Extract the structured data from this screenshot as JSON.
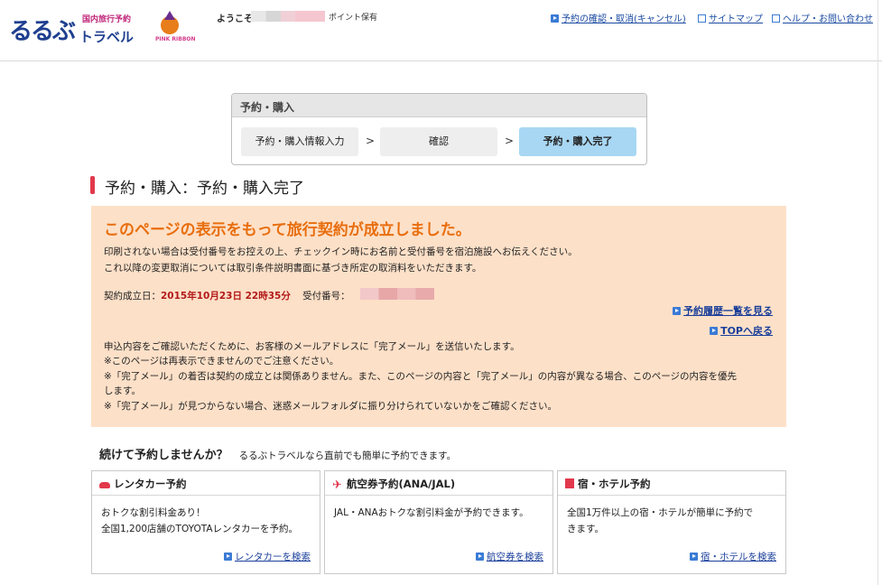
{
  "header": {
    "logo_main": "るるぶ",
    "logo_sub1": "国内旅行予約",
    "logo_sub2": "トラベル",
    "pink_ribbon": "PINK RIBBON",
    "welcome": "ようこそ",
    "points_label": "ポイント保有",
    "links": [
      {
        "label": "予約の確認・取消(キャンセル)",
        "icon": "arrow-icon"
      },
      {
        "label": "サイトマップ",
        "icon": "page-icon"
      },
      {
        "label": "ヘルプ・お問い合わせ",
        "icon": "page-icon"
      }
    ]
  },
  "steps": {
    "title": "予約・購入",
    "items": [
      {
        "label": "予約・購入情報入力"
      },
      {
        "label": "確認"
      },
      {
        "label": "予約・購入完了"
      }
    ],
    "separator": ">",
    "active_index": 2
  },
  "page_title": "予約・購入：予約・購入完了",
  "notice": {
    "title": "このページの表示をもって旅行契約が成立しました。",
    "line1": "印刷されない場合は受付番号をお控えの上、チェックイン時にお名前と受付番号を宿泊施設へお伝えください。",
    "line2": "これ以降の変更取消については取引条件説明書面に基づき所定の取消料をいただきます。",
    "contract_label": "契約成立日：",
    "contract_date": "2015年10月23日 22時35分",
    "receipt_label": "受付番号：",
    "history_link": "予約履歴一覧を見る",
    "top_link": "TOPへ戻る",
    "mail1": "申込内容をご確認いただくために、お客様のメールアドレスに「完了メール」を送信いたします。",
    "mail2": "※このページは再表示できませんのでご注意ください。",
    "mail3a": "※「完了メール」の着否は契約の成立とは関係ありません。また、このページの内容と「完了メール」の内容が異なる場合、このページの内容を優先",
    "mail3b": "します。",
    "mail4": "※「完了メール」が見つからない場合、迷惑メールフォルダに振り分けられていないかをご確認ください。"
  },
  "continue": {
    "question": "続けて予約しませんか？",
    "desc": "るるぶトラベルなら直前でも簡単に予約できます。"
  },
  "cards": [
    {
      "title": "レンタカー予約",
      "icon": "car-icon",
      "body1": "おトクな割引料金あり！",
      "body2": "全国1,200店舗のTOYOTAレンタカーを予約。",
      "link": "レンタカーを検索"
    },
    {
      "title": "航空券予約(ANA/JAL)",
      "icon": "plane-icon",
      "body1": "JAL・ANAおトクな割引料金が予約できます。",
      "body2": "",
      "link": "航空券を検索"
    },
    {
      "title": "宿・ホテル予約",
      "icon": "hotel-icon",
      "body1": "全国1万件以上の宿・ホテルが簡単に予約で",
      "body2": "きます。",
      "link": "宿・ホテルを検索"
    }
  ],
  "colors": {
    "brand_navy": "#1f3f8f",
    "notice_bg": "#fde0c8",
    "notice_title": "#e86e0e",
    "accent_red": "#e2384c",
    "active_step": "#a8d7f3",
    "link": "#1a3f9a"
  }
}
